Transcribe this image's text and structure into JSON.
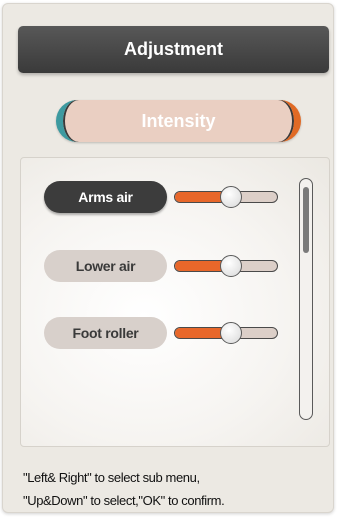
{
  "title": "Adjustment",
  "tab": {
    "label": "Intensity"
  },
  "items": [
    {
      "label": "Arms air",
      "selected": true,
      "level": 0.55
    },
    {
      "label": "Lower air",
      "selected": false,
      "level": 0.55
    },
    {
      "label": "Foot roller",
      "selected": false,
      "level": 0.55
    }
  ],
  "hint": {
    "line1": "\"Left& Right\" to select sub menu,",
    "line2": "\"Up&Down\" to select,\"OK\" to confirm."
  },
  "colors": {
    "accent_orange": "#e8672a",
    "accent_teal": "#3d9aa0",
    "selected_bg": "#3c3c3c",
    "unselected_bg": "#d8d0cb"
  }
}
